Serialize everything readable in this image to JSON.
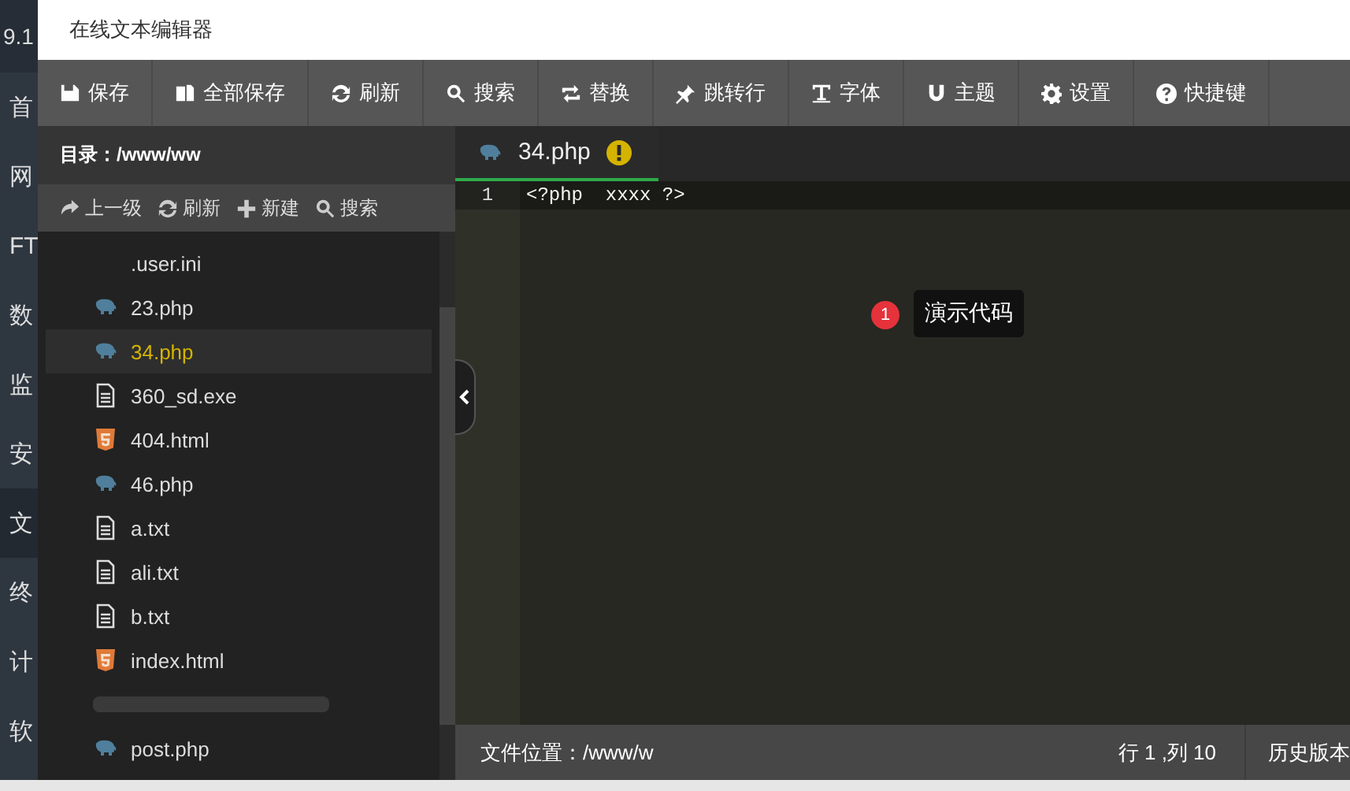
{
  "background_nav": {
    "header": "9.1",
    "items": [
      {
        "label": "首",
        "selected": false
      },
      {
        "label": "网",
        "selected": false
      },
      {
        "label": "FT",
        "selected": false
      },
      {
        "label": "数",
        "selected": false
      },
      {
        "label": "监",
        "selected": false
      },
      {
        "label": "安",
        "selected": false
      },
      {
        "label": "文",
        "selected": true
      },
      {
        "label": "终",
        "selected": false
      },
      {
        "label": "计",
        "selected": false
      },
      {
        "label": "软",
        "selected": false
      }
    ]
  },
  "dialog": {
    "title": "在线文本编辑器"
  },
  "toolbar": [
    {
      "kind": "save",
      "label": "保存"
    },
    {
      "kind": "copy",
      "label": "全部保存"
    },
    {
      "kind": "refresh",
      "label": "刷新"
    },
    {
      "kind": "search",
      "label": "搜索"
    },
    {
      "kind": "replace",
      "label": "替换"
    },
    {
      "kind": "pin",
      "label": "跳转行"
    },
    {
      "kind": "font",
      "label": "字体"
    },
    {
      "kind": "magnet",
      "label": "主题"
    },
    {
      "kind": "gear",
      "label": "设置"
    },
    {
      "kind": "help",
      "label": "快捷键"
    }
  ],
  "explorer": {
    "path": "目录：/www/ww",
    "actions": [
      {
        "kind": "share",
        "label": "上一级"
      },
      {
        "kind": "refresh",
        "label": "刷新"
      },
      {
        "kind": "plus",
        "label": "新建"
      },
      {
        "kind": "search",
        "label": "搜索"
      }
    ],
    "files": [
      {
        "kind": "none",
        "name": ".user.ini",
        "selected": false
      },
      {
        "kind": "php",
        "name": "23.php",
        "selected": false
      },
      {
        "kind": "php",
        "name": "34.php",
        "selected": true
      },
      {
        "kind": "text",
        "name": "360_sd.exe",
        "selected": false
      },
      {
        "kind": "html",
        "name": "404.html",
        "selected": false
      },
      {
        "kind": "php",
        "name": "46.php",
        "selected": false
      },
      {
        "kind": "text",
        "name": "a.txt",
        "selected": false
      },
      {
        "kind": "text",
        "name": "ali.txt",
        "selected": false
      },
      {
        "kind": "text",
        "name": "b.txt",
        "selected": false
      },
      {
        "kind": "html",
        "name": "index.html",
        "selected": false
      },
      {
        "kind": "redacted",
        "selected": false
      },
      {
        "kind": "php",
        "name": "post.php",
        "selected": false
      }
    ]
  },
  "editor": {
    "tabs": [
      {
        "kind": "php",
        "name": "34.php",
        "selected": true,
        "modified": true
      }
    ],
    "lines": [
      {
        "number": "1",
        "code": "<?php  xxxx ?>",
        "active": true
      }
    ],
    "annotation": {
      "badge": "1",
      "text": "演示代码"
    }
  },
  "status_bar": {
    "location": "文件位置：/www/w",
    "cursor": "行 1 ,列 10",
    "history": "历史版本"
  }
}
